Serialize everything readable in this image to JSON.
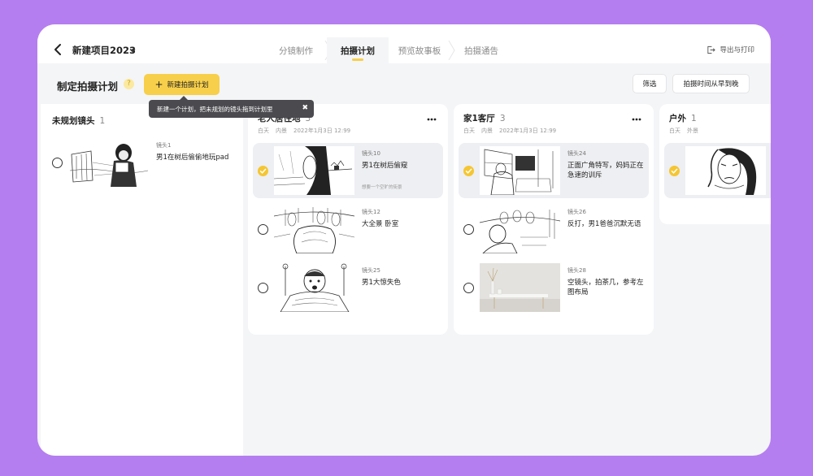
{
  "header": {
    "project_title": "新建项目2023",
    "tabs": [
      {
        "label": "分镜制作",
        "active": false
      },
      {
        "label": "拍摄计划",
        "active": true
      },
      {
        "label": "预览故事板",
        "active": false
      },
      {
        "label": "拍摄通告",
        "active": false
      }
    ],
    "export_label": "导出与打印"
  },
  "toolbar": {
    "page_title": "制定拍摄计划",
    "help_glyph": "?",
    "new_plan_label": "新建拍摄计划",
    "tooltip": "新建一个计划，把未规划的镜头拖到计划里",
    "filter_label": "筛选",
    "sort_label": "拍摄时间从早到晚"
  },
  "unplanned": {
    "title": "未规划镜头",
    "count": "1",
    "shots": [
      {
        "num": "镜头1",
        "desc": "男1在树后偷偷地玩pad",
        "note": ""
      }
    ]
  },
  "plans": [
    {
      "title": "老人居住地",
      "count": "3",
      "meta": [
        "白天",
        "内景",
        "2022年1月3日 12:99"
      ],
      "shots": [
        {
          "num": "镜头10",
          "desc": "男1在树后偷窥",
          "note": "想要一个空旷的街景",
          "selected": true
        },
        {
          "num": "镜头12",
          "desc": "大全景 卧室",
          "note": "",
          "selected": false
        },
        {
          "num": "镜头25",
          "desc": "男1大惊失色",
          "note": "",
          "selected": false
        }
      ]
    },
    {
      "title": "家1客厅",
      "count": "3",
      "meta": [
        "白天",
        "内景",
        "2022年1月3日 12:99"
      ],
      "shots": [
        {
          "num": "镜头24",
          "desc": "正面广角特写，妈妈正在急速的训斥",
          "note": "",
          "selected": true
        },
        {
          "num": "镜头26",
          "desc": "反打，男1爸爸沉默无语",
          "note": "",
          "selected": false
        },
        {
          "num": "镜头28",
          "desc": "空镜头，拍茶几，参考左图布局",
          "note": "",
          "selected": false
        }
      ]
    },
    {
      "title": "户外",
      "count": "1",
      "meta": [
        "白天",
        "外景"
      ],
      "shots": [
        {
          "num": "",
          "desc": "",
          "note": "",
          "selected": true
        }
      ]
    }
  ],
  "colors": {
    "background": "#b57ef0",
    "accent": "#f7cf4a",
    "check": "#f5c632",
    "tooltip": "#4a4a4f"
  }
}
